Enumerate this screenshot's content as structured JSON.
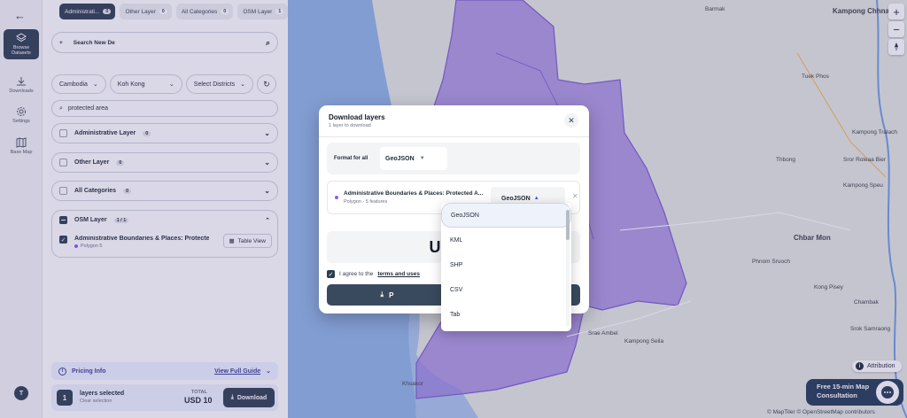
{
  "rail": {
    "items": [
      {
        "label": "Browse Datasets"
      },
      {
        "label": "Downloads"
      },
      {
        "label": "Settings"
      },
      {
        "label": "Base Map"
      }
    ],
    "user_initial": "T"
  },
  "tabs": [
    {
      "label": "Administrati...",
      "count": "0",
      "active": true
    },
    {
      "label": "Other Layer",
      "count": "0"
    },
    {
      "label": "All Categories",
      "count": "0"
    },
    {
      "label": "OSM Layer",
      "count": "1"
    }
  ],
  "search": {
    "value": "Search New De"
  },
  "selectors": {
    "country": "Cambodia",
    "province": "Koh Kong",
    "district": "Select Districts"
  },
  "filter": {
    "value": "protected area"
  },
  "categories": [
    {
      "label": "Administrative Layer",
      "count": "0"
    },
    {
      "label": "Other Layer",
      "count": "0"
    },
    {
      "label": "All Categories",
      "count": "0"
    }
  ],
  "osm": {
    "label": "OSM Layer",
    "count": "1 / 1",
    "item_name": "Administrative Boundaries & Places: Protecte...",
    "item_sub": "Polygon  5",
    "table_view": "Table View"
  },
  "pricing": {
    "label": "Pricing Info",
    "guide": "View Full Guide"
  },
  "footer": {
    "qty": "1",
    "selected_label": "layers selected",
    "clear": "Clear selection",
    "total_label": "TOTAL",
    "total_value": "USD 10",
    "download": "Download"
  },
  "modal": {
    "title": "Download layers",
    "subtitle": "1 layer to download",
    "format_for_all_label": "Format for all",
    "format_for_all_value": "GeoJSON",
    "layer_name": "Administrative Boundaries & Places: Protected A...",
    "layer_sub": "Polygon · 5 features",
    "layer_format": "GeoJSON",
    "price_fragment": "US",
    "agree_prefix": "I agree to the",
    "agree_link": "terms and uses",
    "download_fragment": "P"
  },
  "format_options": [
    "GeoJSON",
    "KML",
    "SHP",
    "CSV",
    "Tab"
  ],
  "map": {
    "labels": {
      "barmak": "Barmak",
      "kampong_chhnang": "Kampong Chhnang",
      "tuek_phos": "Tuek Phos",
      "kampong_tralach": "Kampong Tralach",
      "sror_roleaa_bier": "Sror Roleaa Bier",
      "thbong": "Thbong",
      "kampong_speu": "Kampong Speu",
      "chbar_mon": "Chbar Mon",
      "phnom_sruoch": "Phnom Sruoch",
      "kong_pisey": "Kong Pisey",
      "chambak": "Chambak",
      "srae_ambel": "Srae Ambel",
      "kampong_seila": "Kampong Seila",
      "srok_samraong": "Srok Samraong",
      "khsakor": "Khsakor"
    },
    "attribution": "Attribution",
    "consult": {
      "line1": "Free 15-min Map",
      "line2": "Consultation"
    },
    "copyright": "© MapTiler © OpenStreetMap contributors",
    "colors": {
      "land": "#e4e8e2",
      "water": "#8fb5e6",
      "polygon": "#9b7fe0",
      "overlay": "#56488c"
    }
  }
}
